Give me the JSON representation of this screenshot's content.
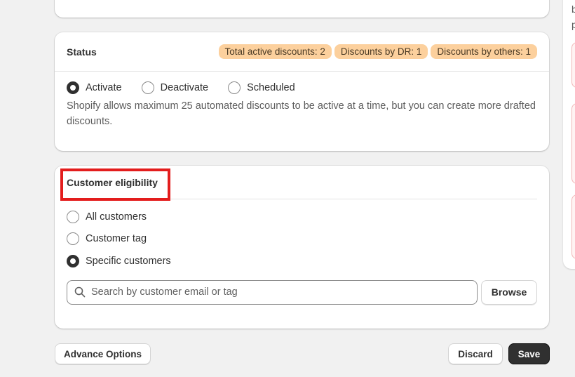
{
  "status": {
    "title": "Status",
    "badges": [
      "Total active discounts: 2",
      "Discounts by DR: 1",
      "Discounts by others: 1"
    ],
    "options": [
      "Activate",
      "Deactivate",
      "Scheduled"
    ],
    "selected": "Activate",
    "help": "Shopify allows maximum 25 automated discounts to be active at a time, but you can create more drafted discounts."
  },
  "eligibility": {
    "title": "Customer eligibility",
    "options": [
      "All customers",
      "Customer tag",
      "Specific customers"
    ],
    "selected": "Specific customers",
    "search_placeholder": "Search by customer email or tag",
    "browse": "Browse"
  },
  "footer": {
    "advance": "Advance Options",
    "discard": "Discard",
    "save": "Save"
  },
  "right_panel": {
    "line1": "b",
    "line2": "p"
  },
  "colors": {
    "badge": "#fcd09d",
    "highlight": "#e31d1d",
    "primary": "#303030"
  }
}
